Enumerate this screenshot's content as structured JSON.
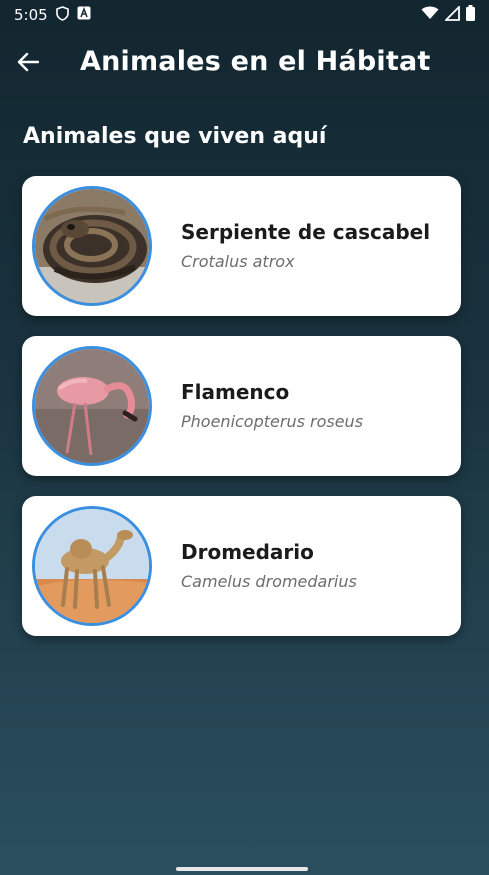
{
  "status_bar": {
    "time": "5:05",
    "icons_left": [
      "shield-icon",
      "font-badge-icon"
    ],
    "icons_right": [
      "wifi-icon",
      "signal-icon",
      "battery-icon"
    ]
  },
  "header": {
    "back_icon": "arrow-left-icon",
    "title": "Animales en el Hábitat"
  },
  "section": {
    "title": "Animales que viven aquí"
  },
  "animals": [
    {
      "name": "Serpiente de cascabel",
      "scientific": "Crotalus atrox",
      "image": "rattlesnake-photo"
    },
    {
      "name": "Flamenco",
      "scientific": "Phoenicopterus roseus",
      "image": "flamingo-photo"
    },
    {
      "name": "Dromedario",
      "scientific": "Camelus dromedarius",
      "image": "dromedary-photo"
    }
  ],
  "colors": {
    "background_top": "#12262f",
    "background_bottom": "#2b4f5e",
    "card": "#ffffff",
    "avatar_border": "#3b8fe0",
    "name_text": "#1b1b1b",
    "scientific_text": "#6d6d6d"
  }
}
